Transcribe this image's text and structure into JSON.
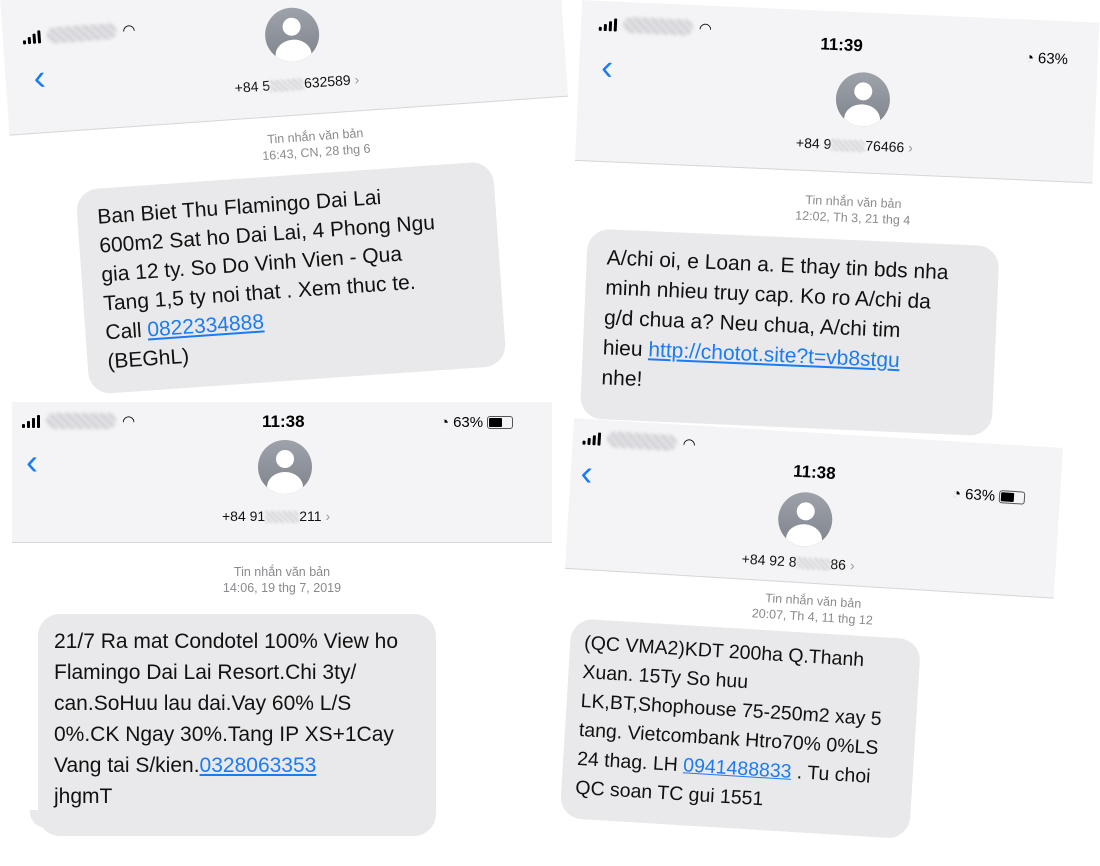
{
  "screens": [
    {
      "id": "top-left",
      "contact_number_prefix": "+84 5",
      "contact_number_suffix": "632589",
      "chevron": "›",
      "meta_label": "Tin nhắn văn bản",
      "meta_time": "16:43, CN, 28 thg 6",
      "message_lines": [
        "Ban Biet Thu Flamingo Dai Lai",
        "600m2 Sat ho Dai Lai, 4 Phong Ngu",
        "gia 12 ty. So Do Vinh Vien - Qua",
        "Tang 1,5 ty noi that . Xem thuc te."
      ],
      "link_prefix": "Call ",
      "link": "0822334888",
      "last_line": "(BEGhL)"
    },
    {
      "id": "top-right",
      "time": "11:39",
      "battery": "63%",
      "contact_number_prefix": "+84 9",
      "contact_number_suffix": "76466",
      "chevron": "›",
      "meta_label": "Tin nhắn văn bản",
      "meta_time": "12:02, Th 3, 21 thg 4",
      "message_lines": [
        "A/chi oi, e Loan a. E thay tin bds nha",
        "minh nhieu truy cap. Ko ro A/chi da",
        "g/d chua a? Neu chua, A/chi tim"
      ],
      "link_prefix": "hieu ",
      "link": "http://chotot.site?t=vb8stgu",
      "last_line": "nhe!"
    },
    {
      "id": "bottom-left",
      "time": "11:38",
      "battery": "63%",
      "contact_number_prefix": "+84 91",
      "contact_number_suffix": "211",
      "chevron": "›",
      "meta_label": "Tin nhắn văn bản",
      "meta_time": "14:06, 19 thg 7, 2019",
      "message_lines": [
        "21/7 Ra mat Condotel 100% View ho",
        "Flamingo Dai Lai Resort.Chi 3ty/",
        "can.SoHuu lau dai.Vay 60% L/S",
        "0%.CK Ngay 30%.Tang IP XS+1Cay"
      ],
      "link_prefix": "Vang tai S/kien.",
      "link": "0328063353",
      "last_line": "jhgmT"
    },
    {
      "id": "bottom-right",
      "time": "11:38",
      "battery": "63%",
      "contact_number_prefix": "+84 92 8",
      "contact_number_suffix": "86",
      "chevron": "›",
      "meta_label": "Tin nhắn văn bản",
      "meta_time": "20:07, Th 4, 11 thg 12",
      "message_lines": [
        "(QC VMA2)KDT 200ha Q.Thanh",
        "Xuan. 15Ty So huu",
        "LK,BT,Shophouse 75-250m2 xay 5",
        "tang. Vietcombank Htro70% 0%LS"
      ],
      "link_prefix": "24 thag. LH ",
      "link": "0941488833",
      "link_suffix": " . Tu choi",
      "last_line": "QC soan TC gui 1551"
    }
  ],
  "colors": {
    "link": "#1a7cf3",
    "bubble": "#e9e9eb",
    "header": "#f4f4f6",
    "meta": "#8a8a8e"
  },
  "icons": [
    "signal-bars-icon",
    "wifi-icon",
    "back-chevron-icon",
    "contact-avatar-icon",
    "alarm-icon",
    "battery-icon"
  ]
}
